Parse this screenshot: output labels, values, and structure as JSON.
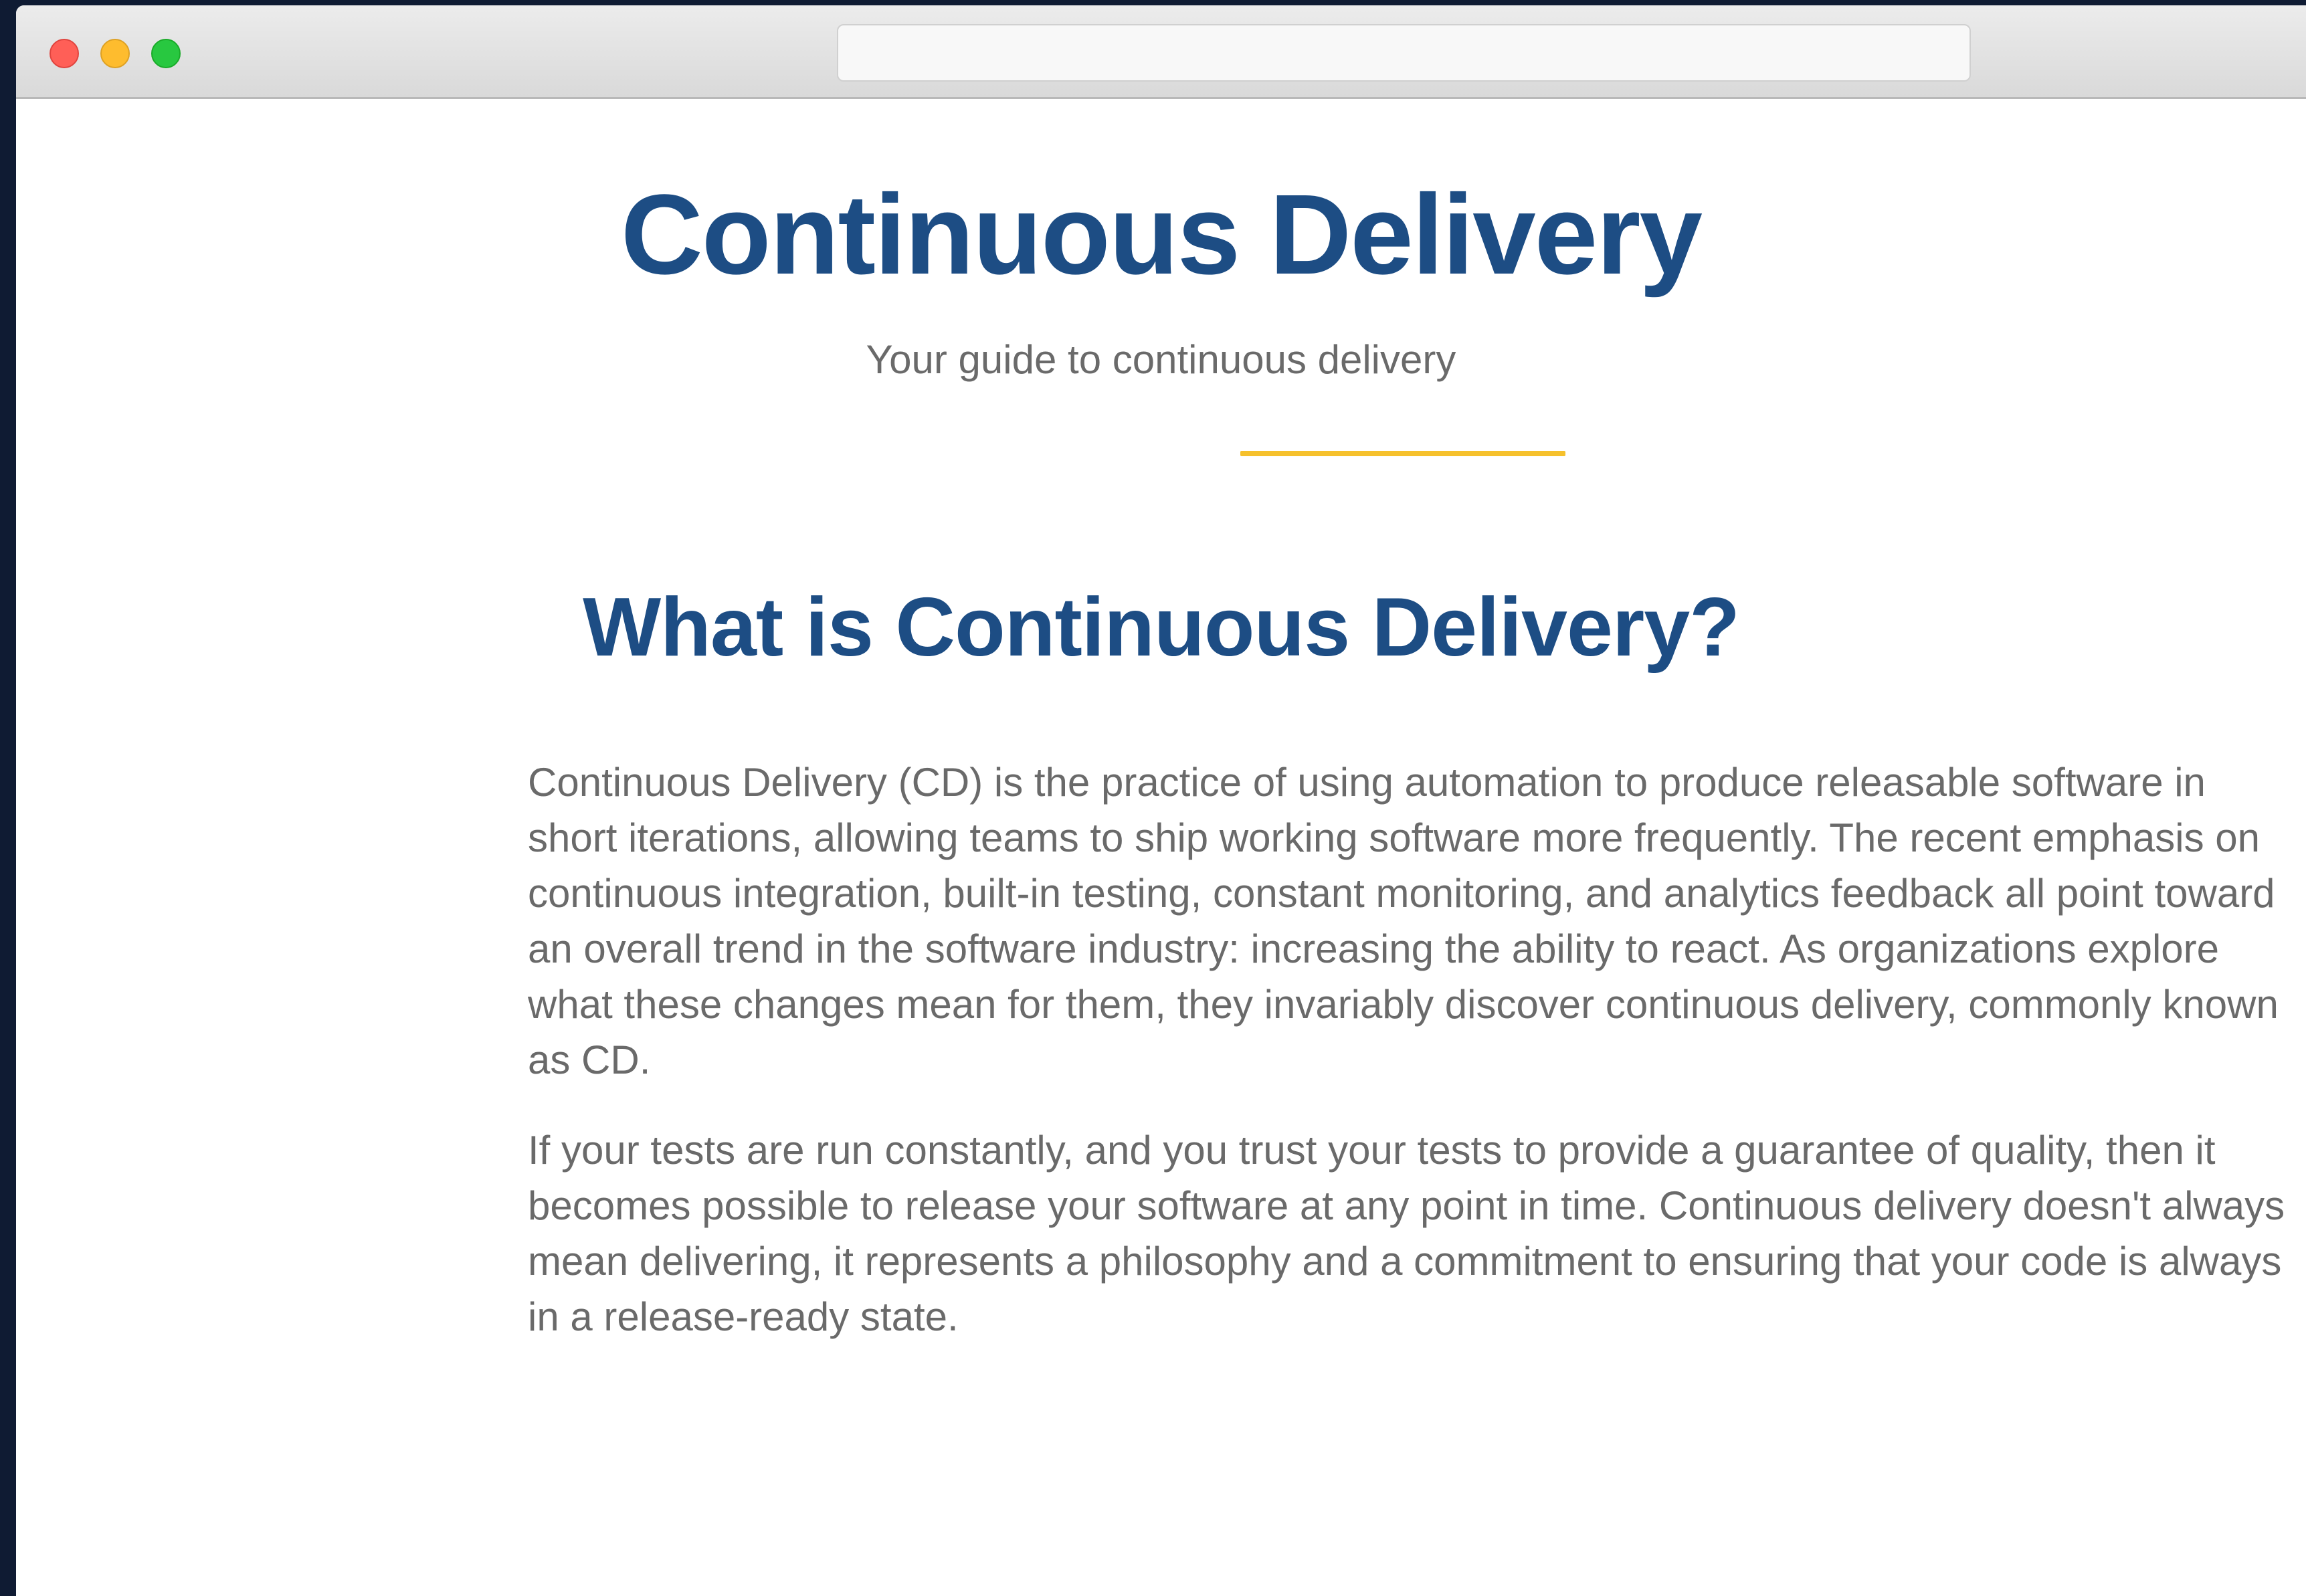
{
  "window": {
    "controls": {
      "close_color": "#ff5f57",
      "minimize_color": "#febc2e",
      "zoom_color": "#28c840"
    },
    "url": ""
  },
  "page": {
    "title": "Continuous Delivery",
    "subtitle": "Your guide to continuous delivery",
    "accent_color": "#f6c12c",
    "heading_color": "#1d4d84",
    "section": {
      "heading": "What is Continuous Delivery?",
      "paragraphs": [
        "Continuous Delivery (CD) is the practice of using automation to produce releasable software in short iterations, allowing teams to ship working software more frequently. The recent emphasis on continuous integration, built-in testing, constant monitoring, and analytics feedback all point toward an overall trend in the software industry: increasing the ability to react. As organizations explore what these changes mean for them, they invariably discover continuous delivery, commonly known as CD.",
        "If your tests are run constantly, and you trust your tests to provide a guarantee of quality, then it becomes possible to release your software at any point in time. Continuous delivery doesn't always mean delivering, it represents a philosophy and a commitment to ensuring that your code is always in a release-ready state."
      ]
    }
  }
}
